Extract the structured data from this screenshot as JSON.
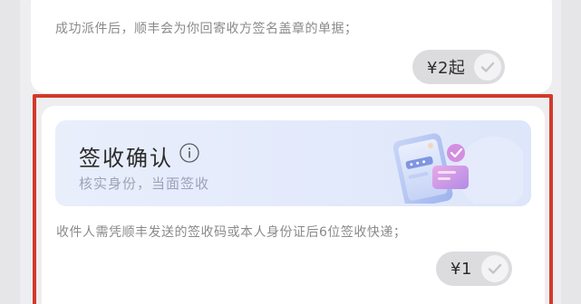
{
  "top_card": {
    "description": "成功派件后，顺丰会为你回寄收方签名盖章的单据；",
    "price": "¥2起"
  },
  "selected_card": {
    "title": "签收确认",
    "subtitle": "核实身份，当面签收",
    "description": "收件人需凭顺丰发送的签收码或本人身份证后6位签收快递；",
    "price": "¥1"
  },
  "colors": {
    "highlight": "#d23a2a",
    "banner": "#e4ebfb",
    "pill": "#dcdcdf"
  },
  "icons": [
    "info-icon",
    "check-icon",
    "phone-sign-illustration"
  ]
}
